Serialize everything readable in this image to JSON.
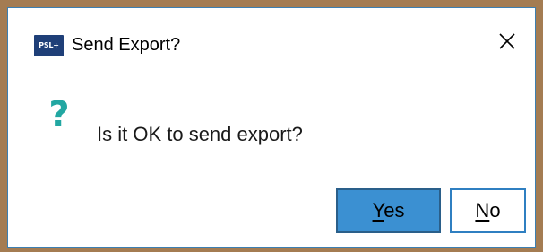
{
  "dialog": {
    "title": "Send Export?",
    "app_icon_text": "PSL+",
    "message": "Is it OK to send export?",
    "icon": "question-mark-icon",
    "icon_glyph": "?",
    "close_icon": "close-icon"
  },
  "buttons": {
    "yes": {
      "mnemonic": "Y",
      "rest": "es",
      "full_label": "Yes"
    },
    "no": {
      "mnemonic": "N",
      "rest": "o",
      "full_label": "No"
    }
  },
  "colors": {
    "background": "#a47c52",
    "dialog_border": "#3c7fb1",
    "question_icon": "#22a7a2",
    "yes_button_fill": "#3b90d2",
    "no_button_border": "#2f7fc1",
    "app_icon_fill": "#1f3f78"
  }
}
